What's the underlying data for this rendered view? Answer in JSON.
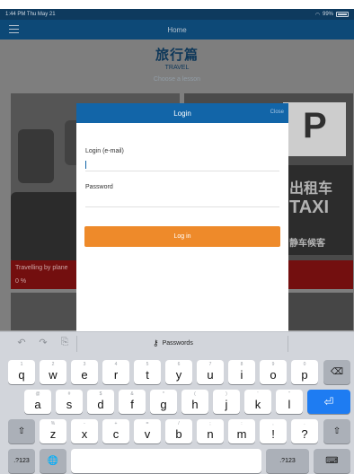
{
  "status_bar": {
    "time": "1:44 PM",
    "date": "Thu May 21",
    "battery": "99%"
  },
  "nav": {
    "title": "Home"
  },
  "page": {
    "heading_cn": "旅行篇",
    "heading_en": "TRAVEL",
    "subheading": "Choose a lesson",
    "cards": [
      {
        "caption": "Travelling by plane",
        "progress": "0 %"
      }
    ],
    "taxi_sign_cn": "出租车",
    "taxi_sign_en": "TAXI",
    "taxi_sign_sub": "静车候客",
    "parking": "P"
  },
  "modal": {
    "title": "Login",
    "close_label": "Close",
    "email_label": "Login (e-mail)",
    "email_value": "",
    "password_label": "Password",
    "password_value": "",
    "submit_label": "Log in"
  },
  "keyboard": {
    "toolbar": {
      "undo": "↶",
      "redo": "↷",
      "paste": "⎘",
      "passwords_label": "Passwords",
      "key_icon": "⚷"
    },
    "rows": [
      [
        {
          "main": "q",
          "hint": "1"
        },
        {
          "main": "w",
          "hint": "2"
        },
        {
          "main": "e",
          "hint": "3"
        },
        {
          "main": "r",
          "hint": "4"
        },
        {
          "main": "t",
          "hint": "5"
        },
        {
          "main": "y",
          "hint": "6"
        },
        {
          "main": "u",
          "hint": "7"
        },
        {
          "main": "i",
          "hint": "8"
        },
        {
          "main": "o",
          "hint": "9"
        },
        {
          "main": "p",
          "hint": "0"
        }
      ],
      [
        {
          "main": "a",
          "hint": "@"
        },
        {
          "main": "s",
          "hint": "#"
        },
        {
          "main": "d",
          "hint": "$"
        },
        {
          "main": "f",
          "hint": "&"
        },
        {
          "main": "g",
          "hint": "*"
        },
        {
          "main": "h",
          "hint": "("
        },
        {
          "main": "j",
          "hint": ")"
        },
        {
          "main": "k",
          "hint": "'"
        },
        {
          "main": "l",
          "hint": "\""
        }
      ],
      [
        {
          "main": "z",
          "hint": "%"
        },
        {
          "main": "x",
          "hint": "-"
        },
        {
          "main": "c",
          "hint": "+"
        },
        {
          "main": "v",
          "hint": "="
        },
        {
          "main": "b",
          "hint": "/"
        },
        {
          "main": "n",
          "hint": ";"
        },
        {
          "main": "m",
          "hint": ":"
        },
        {
          "main": "!",
          "hint": ","
        },
        {
          "main": "?",
          "hint": "."
        }
      ]
    ],
    "delete_glyph": "⌫",
    "return_glyph": "⏎",
    "shift_glyph": "⇧",
    "numbers_label": ".?123",
    "globe_glyph": "🌐",
    "hide_glyph": "⌨"
  }
}
